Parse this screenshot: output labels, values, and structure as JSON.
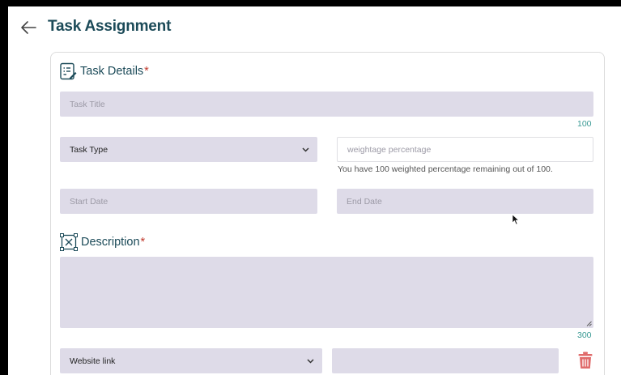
{
  "header": {
    "title": "Task Assignment",
    "back_icon": "arrow-left-icon"
  },
  "task_details": {
    "heading": "Task Details",
    "required_mark": "*",
    "icon": "clipboard-list-icon",
    "title_placeholder": "Task Title",
    "title_counter": "100",
    "task_type_selected": "Task Type",
    "weightage_placeholder": "weightage percentage",
    "weightage_hint": "You have 100 weighted percentage remaining out of 100.",
    "start_date_placeholder": "Start Date",
    "end_date_placeholder": "End Date"
  },
  "description": {
    "heading": "Description",
    "required_mark": "*",
    "icon": "image-text-icon",
    "counter": "300"
  },
  "links": {
    "type_selected": "Website link",
    "url_value": "",
    "delete_icon": "trash-icon"
  },
  "colors": {
    "title": "#1b4a58",
    "field_bg": "#dedbe8",
    "counter": "#3a9a94",
    "required": "#c0392b",
    "delete": "#e06b6b"
  }
}
